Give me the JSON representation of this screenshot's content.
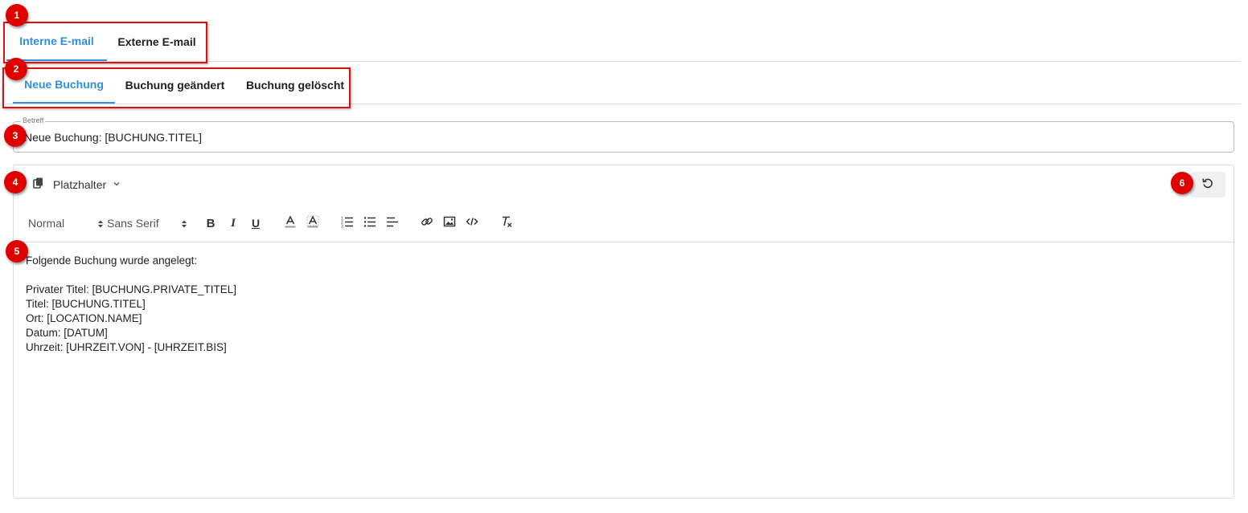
{
  "callouts": [
    "1",
    "2",
    "3",
    "4",
    "5",
    "6"
  ],
  "email_tabs": [
    {
      "label": "Interne E-mail",
      "active": true
    },
    {
      "label": "Externe E-mail",
      "active": false
    }
  ],
  "event_tabs": [
    {
      "label": "Neue Buchung",
      "active": true
    },
    {
      "label": "Buchung geändert",
      "active": false
    },
    {
      "label": "Buchung gelöscht",
      "active": false
    }
  ],
  "subject": {
    "label": "Betreff",
    "value": "Neue Buchung: [BUCHUNG.TITEL]"
  },
  "placeholder_menu": {
    "label": "Platzhalter",
    "icon": "copy-icon"
  },
  "reset_button": {
    "icon": "undo-icon"
  },
  "toolbar": {
    "size_select": "Normal",
    "font_select": "Sans Serif",
    "buttons": [
      "bold",
      "italic",
      "underline",
      "text-color",
      "background-color",
      "ordered-list",
      "bullet-list",
      "align",
      "link",
      "image",
      "code",
      "clear-formatting"
    ]
  },
  "body_lines": [
    "Folgende Buchung wurde angelegt:",
    "",
    "Privater Titel: [BUCHUNG.PRIVATE_TITEL]",
    "Titel: [BUCHUNG.TITEL]",
    "Ort: [LOCATION.NAME]",
    "Datum: [DATUM]",
    "Uhrzeit: [UHRZEIT.VON] - [UHRZEIT.BIS]"
  ],
  "colors": {
    "accent": "#2f8fe0",
    "callout": "#e00000"
  }
}
